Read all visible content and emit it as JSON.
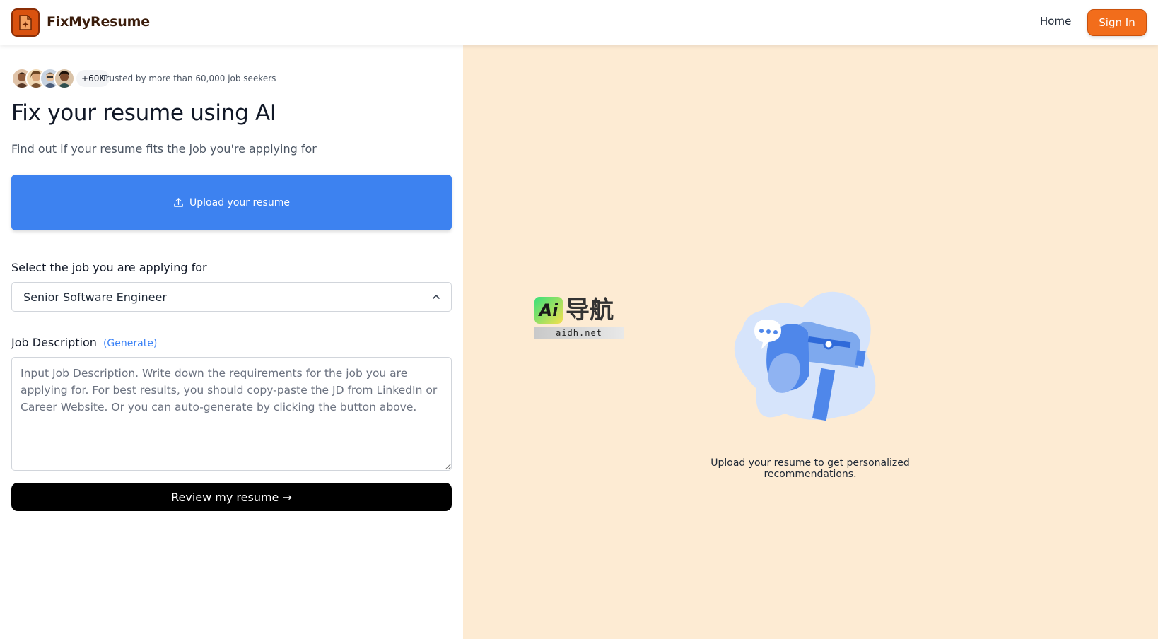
{
  "header": {
    "brand": "FixMyResume",
    "nav_home": "Home",
    "sign_in": "Sign In"
  },
  "social_proof": {
    "count_badge": "+60K",
    "trusted_text": "Trusted by more than 60,000 job seekers"
  },
  "hero": {
    "title": "Fix your resume using AI",
    "subtitle": "Find out if your resume fits the job you're applying for"
  },
  "upload": {
    "label": "Upload your resume"
  },
  "job_select": {
    "label": "Select the job you are applying for",
    "selected": "Senior Software Engineer"
  },
  "job_description": {
    "label": "Job Description",
    "generate_link": "(Generate)",
    "placeholder": "Input Job Description. Write down the requirements for the job you are applying for. For best results, you should copy-paste the JD from LinkedIn or Career Website. Or you can auto-generate by clicking the button above."
  },
  "review": {
    "label": "Review my resume →"
  },
  "right_panel": {
    "message": "Upload your resume to get personalized recommendations."
  },
  "watermark": {
    "logo_text": "Ai",
    "cn_text": "导航",
    "url": "aidh.net"
  },
  "colors": {
    "accent_orange": "#f26d1b",
    "primary_blue": "#3d82f0",
    "right_bg": "#fdebd3"
  }
}
